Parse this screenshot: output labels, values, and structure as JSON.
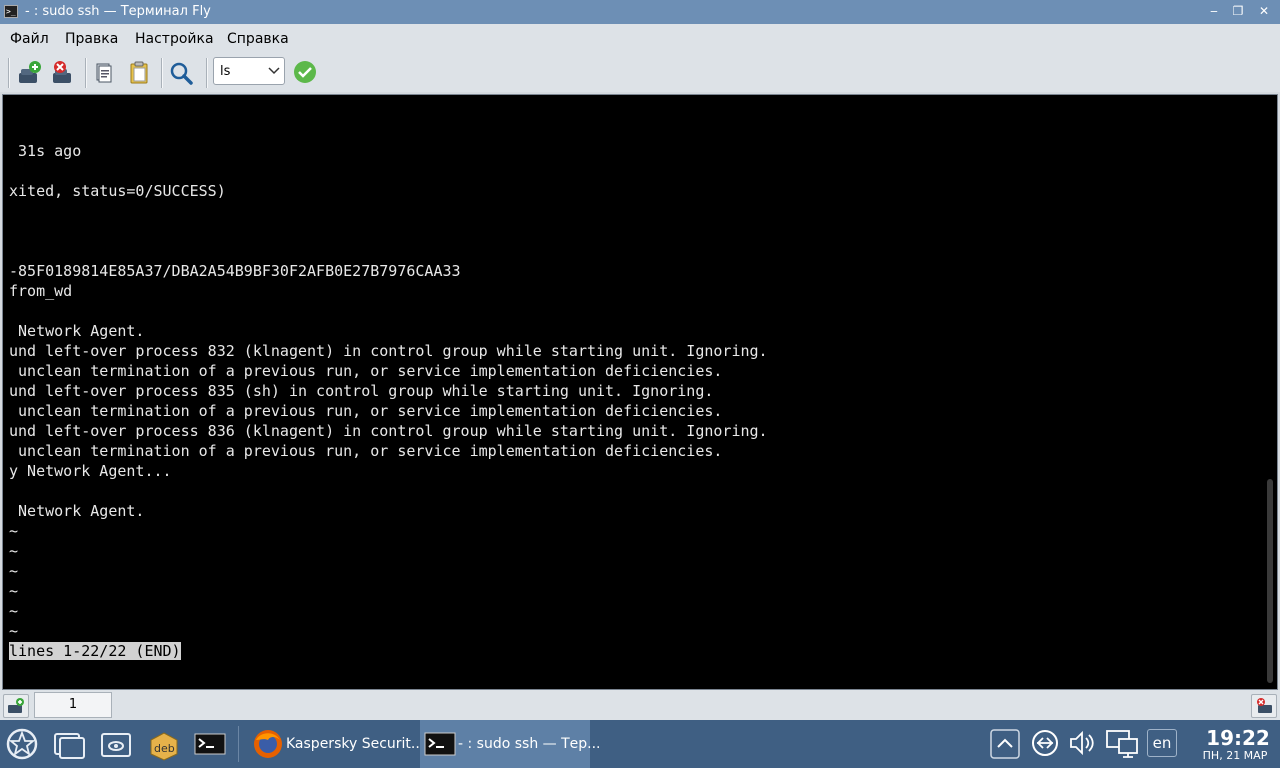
{
  "window": {
    "title": "- : sudo ssh — Терминал Fly",
    "app_icon_glyph": ">_",
    "minimize_glyph": "‒",
    "maximize_glyph": "❐",
    "close_glyph": "✕"
  },
  "menu": {
    "items": [
      "Файл",
      "Правка",
      "Настройка",
      "Справка"
    ]
  },
  "toolbar": {
    "command_value": "ls",
    "icons": [
      "new-session-icon",
      "close-session-icon",
      "copy-icon",
      "paste-icon",
      "find-icon",
      "execute-command-icon"
    ]
  },
  "terminal": {
    "lines": [
      "",
      " 31s ago",
      "",
      "xited, status=0/SUCCESS)",
      "",
      "",
      "",
      "-85F0189814E85A37/DBA2A54B9BF30F2AFB0E27B7976CAA33",
      "from_wd",
      "",
      " Network Agent.",
      "und left-over process 832 (klnagent) in control group while starting unit. Ignoring.",
      " unclean termination of a previous run, or service implementation deficiencies.",
      "und left-over process 835 (sh) in control group while starting unit. Ignoring.",
      " unclean termination of a previous run, or service implementation deficiencies.",
      "und left-over process 836 (klnagent) in control group while starting unit. Ignoring.",
      " unclean termination of a previous run, or service implementation deficiencies.",
      "y Network Agent...",
      "",
      " Network Agent.",
      "~",
      "~",
      "~",
      "~",
      "~",
      "~"
    ],
    "status_line": "lines 1-22/22 (END)"
  },
  "tabs": {
    "items": [
      {
        "label": "1"
      }
    ]
  },
  "taskbar": {
    "tasks": [
      {
        "label": "Kaspersky Securit...",
        "icon": "firefox-icon"
      },
      {
        "label": "- : sudo ssh — Тер...",
        "icon": "terminal-icon"
      }
    ],
    "language": "en",
    "clock": {
      "time": "19:22",
      "date": "ПН, 21 МАР"
    }
  },
  "colors": {
    "titlebar": "#6d8fb5",
    "taskbar": "#3f5f83",
    "terminal_bg": "#000000",
    "terminal_fg": "#e8e8e8"
  }
}
